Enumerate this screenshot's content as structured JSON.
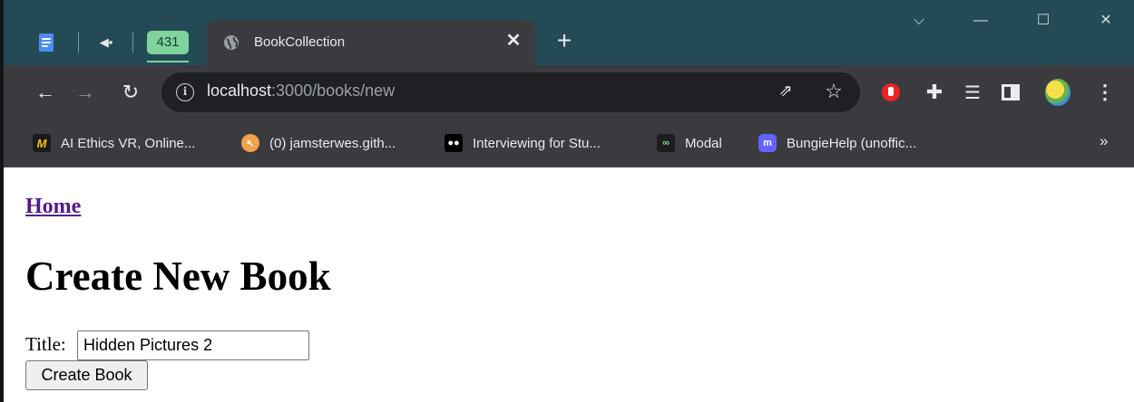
{
  "browser": {
    "pinned_badge": "431",
    "active_tab": {
      "title": "BookCollection"
    },
    "window_controls": {
      "dropdown": "⌵",
      "minimize": "—",
      "maximize": "☐",
      "close": "✕"
    }
  },
  "toolbar": {
    "url_host": "localhost",
    "url_rest": ":3000/books/new"
  },
  "bookmarks": [
    {
      "label": "AI Ethics VR, Online...",
      "icon": "M"
    },
    {
      "label": "(0) jamsterwes.gith...",
      "icon": "↖"
    },
    {
      "label": "Interviewing for Stu...",
      "icon": "●●"
    },
    {
      "label": "Modal",
      "icon": "∞"
    },
    {
      "label": "BungieHelp (unoffic...",
      "icon": "m"
    }
  ],
  "bookmarks_more": "»",
  "page": {
    "home_link": "Home",
    "heading": "Create New Book",
    "title_label": "Title:",
    "title_value": "Hidden Pictures 2",
    "submit_label": "Create Book"
  },
  "colors": {
    "tabstrip": "#244b55",
    "toolbar": "#3b3b3f",
    "badge": "#7fd39c",
    "link_visited": "#551a8b"
  }
}
